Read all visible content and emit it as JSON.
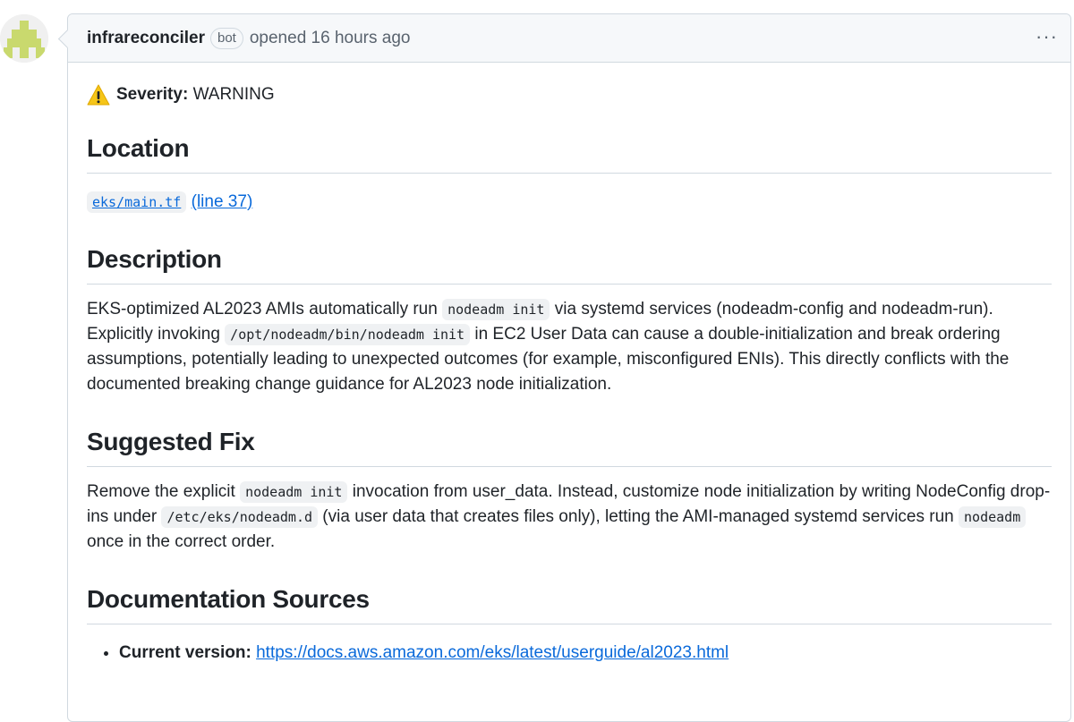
{
  "header": {
    "author": "infrareconciler",
    "badge": "bot",
    "meta": "opened 16 hours ago",
    "more": "···"
  },
  "severity": {
    "label": "Severity:",
    "value": "WARNING"
  },
  "location": {
    "heading": "Location",
    "file": "eks/main.tf",
    "line": "(line 37)"
  },
  "description": {
    "heading": "Description",
    "t1": "EKS-optimized AL2023 AMIs automatically run ",
    "c1": "nodeadm init",
    "t2": " via systemd services (nodeadm-config and nodeadm-run). Explicitly invoking ",
    "c2": "/opt/nodeadm/bin/nodeadm init",
    "t3": " in EC2 User Data can cause a double-initialization and break ordering assumptions, potentially leading to unexpected outcomes (for example, misconfigured ENIs). This directly conflicts with the documented breaking change guidance for AL2023 node initialization."
  },
  "fix": {
    "heading": "Suggested Fix",
    "t1": "Remove the explicit ",
    "c1": "nodeadm init",
    "t2": " invocation from user_data. Instead, customize node initialization by writing NodeConfig drop-ins under ",
    "c2": "/etc/eks/nodeadm.d",
    "t3": " (via user data that creates files only), letting the AMI-managed systemd services run ",
    "c3": "nodeadm",
    "t4": " once in the correct order."
  },
  "docs": {
    "heading": "Documentation Sources",
    "items": [
      {
        "label": "Current version:",
        "url": "https://docs.aws.amazon.com/eks/latest/userguide/al2023.html"
      }
    ]
  },
  "icons": {
    "avatar": "identicon",
    "warning": "warning-icon"
  },
  "colors": {
    "link": "#0969da",
    "avatar": "#c9d96e",
    "warning": "#f5c518"
  }
}
